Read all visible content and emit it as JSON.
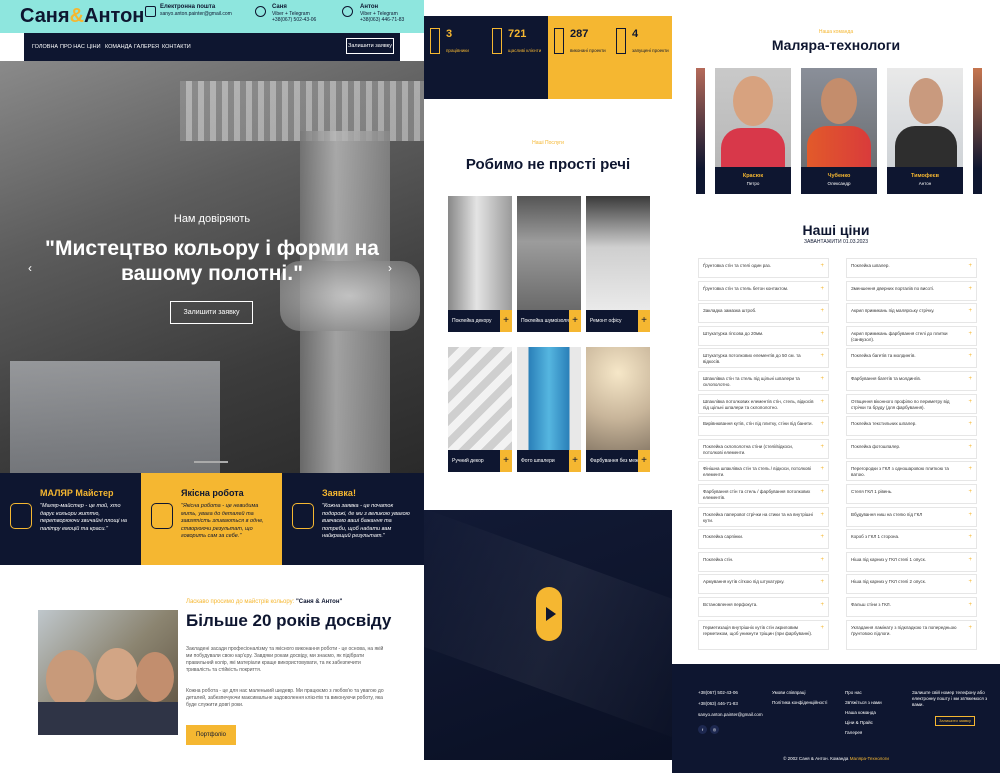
{
  "header": {
    "logo_left": "Саня",
    "logo_amp": "&",
    "logo_right": "Антон",
    "email_title": "Електронна пошта",
    "email": "sanyo.anton.painter@gmail.com",
    "contact1_name": "Саня",
    "contact1_apps": "Viber + Telegram",
    "contact1_phone": "+38(067) 502-43-06",
    "contact2_name": "Антон",
    "contact2_apps": "Viber + Telegram",
    "contact2_phone": "+38(063) 446-71-83"
  },
  "nav": {
    "items": [
      "Головна",
      "Про нас",
      "Ціни",
      "Команда",
      "Галерея",
      "Контакти"
    ],
    "cta": "Залишити заявку"
  },
  "hero": {
    "subtitle": "Нам довіряють",
    "title": "\"Мистецтво кольору і форми на вашому полотні.\"",
    "button": "Залишити заявку"
  },
  "features": [
    {
      "title": "МАЛЯР Майстер",
      "text": "\"Маляр-майстер - це той, хто дарує кольори життю, перетворюючи звичайні площі на палітру емоцій та краси.\""
    },
    {
      "title": "Якісна робота",
      "text": "\"Якісна робота - це невидима мить, увага до деталей та завзятість зливаються в одне, створюючи результат, що говорить сам за себе.\""
    },
    {
      "title": "Заявка!",
      "text": "\"Кожна заявка - це початок подорожі, де ми з великою увагою вивчаємо ваші бажання та потреби, щоб надати вам найкращий результат.\""
    }
  ],
  "about": {
    "tag": "Ласкаво просимо до майстрів кольору: ",
    "tag_brand": "\"Саня & Антон\"",
    "heading": "Більше 20 років досвіду",
    "p1": "Закладені засади професіоналізму та якісного виконання роботи - це основа, на якій ми побудували свою кар'єру. Завдяки рокам досвіду, ми знаємо, як підібрати правильний колір, які матеріали краще використовувати, та як забезпечити тривалість та стійкість покриття.",
    "p2": "Кожна робота - це для нас маленький шедевр. Ми працюємо з любов'ю та увагою до деталей, забезпечуючи максимальне задоволення клієнтів та виконуючи роботу, яка буде служити довгі роки.",
    "button": "Портфоліо"
  },
  "stats": [
    {
      "num": "3",
      "label": "працівники"
    },
    {
      "num": "721",
      "label": "щасливі клієнти"
    },
    {
      "num": "287",
      "label": "виконані проекти"
    },
    {
      "num": "4",
      "label": "запущені проекти"
    }
  ],
  "gallery": {
    "tag": "Наші Послуги",
    "heading": "Робимо не прості речі",
    "items": [
      "Поклейка декору",
      "Поклейка шумоізоляції",
      "Ремонт офісу",
      "Ручний декор",
      "Фото шпалери",
      "Фарбування без меж"
    ],
    "plus": "+"
  },
  "team": {
    "tag": "Наша команда",
    "heading": "Маляра-технологи",
    "members": [
      {
        "surname": "Красюк",
        "name": "Петро"
      },
      {
        "surname": "Чубенко",
        "name": "Олександр"
      },
      {
        "surname": "Тимофеєв",
        "name": "Антон"
      }
    ]
  },
  "prices": {
    "heading": "Наші ціни",
    "sub": "ЗАВАНТАЖИТИ 01.03.2023",
    "plus": "+",
    "left": [
      "Ґрунтовка стін та стелі один раз.",
      "Ґрунтовка стін та стель бетон контактом.",
      "Закладка замазка штроб.",
      "Штукатурка гіпсова до 20мм.",
      "Штукатурка потолкових елементів до 50 см. та відкосів.",
      "Шпаклівка стін та стель під щільні шпалери та склополотно.",
      "Шпаклівка потолкових елементів стін, стель, відкосів під щільні шпалери та склополотно.",
      "Вирівнювання кутів, стін під плитку, стіни під банети.",
      "Поклейка склополотна стіни (стелі/відкоси, потолкові елементи.",
      "Фінішна шпаклівка стін та стель / відкоси, потолкові елементи.",
      "Фарбування стін та стель / фарбування потолкових елементів.",
      "Поклейка паперової стрічки на стики та на внутрішні кути.",
      "Поклейка сарпінки.",
      "Поклейка стін.",
      "Армування кутів сіткою під штукатурку.",
      "Встановлення перфокута.",
      "Герметизація внутрішніх кутів стін акриловим герметиком, щоб уникнути тріщин (при фарбуванні)."
    ],
    "right": [
      "Поклейка шпалер.",
      "Зменшення дверних порталів по висоті.",
      "Акрил примикань під малярську стрічку.",
      "Акрил примикань фарбування стелі до плитки (санвузол).",
      "Поклейка багетів та молдингів.",
      "Фарбування багетів та молдингів.",
      "Отвщення віконного профілю по периметру від стрічки та бруду (для фарбування).",
      "Поклейка текстильних шпалер.",
      "Поклейка фотошпалер.",
      "Перегородки з ГКЛ з одношаровою плиткою та ватою.",
      "Стеля ГКЛ 1 рівень.",
      "Вбудування ниш на стелю під ГКЛ",
      "Короб з ГКЛ 1 сторона.",
      "Ніша під карниз у ГКЛ стелі 1 опуск.",
      "Ніша під карниз у ГКЛ стелі 2 опуск.",
      "Фальш стіни з ГКЛ.",
      "Укладання ламінату з підкладкою та попередньою ґрунтовою підлоги."
    ]
  },
  "footer": {
    "phone1": "+38(067) 502-43-06",
    "phone2": "+38(063) 446-71-83",
    "email": "sanyo.anton.painter@gmail.com",
    "links1": [
      "Умови співпраці",
      "Політика конфіденційності"
    ],
    "links2": [
      "Про нас",
      "Зв'яжіться з нами",
      "Наша команда",
      "Ціни & Прайс",
      "Галерея"
    ],
    "cta_text": "Залиште свій номер телефону або електронну пошту і ми зв'яжемося з вами.",
    "cta_button": "Залишити заявку",
    "social": [
      "f",
      "◎"
    ],
    "copyright": "© 2002 Саня & Антон. Команда ",
    "copyright_brand": "Маляра-Технологи"
  },
  "colors": {
    "navy": "#0e1630",
    "gold": "#f5b731",
    "mint": "#8ee6de"
  }
}
